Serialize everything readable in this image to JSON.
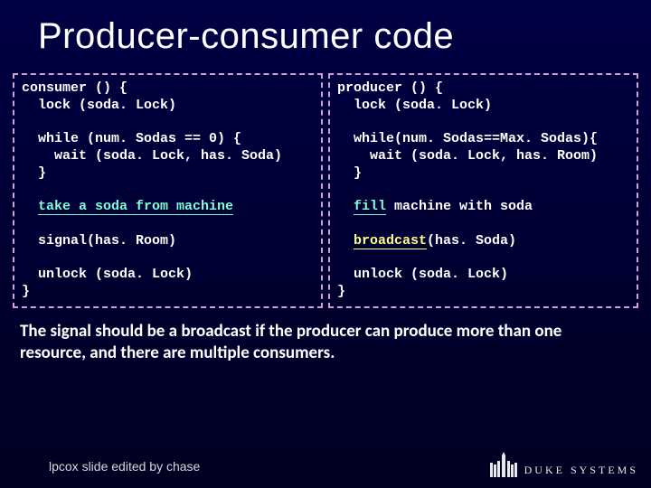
{
  "title": "Producer-consumer code",
  "consumer": {
    "l1": "consumer () {",
    "l2": "  lock (soda. Lock)",
    "l3": "",
    "l4": "  while (num. Sodas == 0) {",
    "l5": "    wait (soda. Lock, has. Soda)",
    "l6": "  }",
    "l7": "",
    "take1": "  ",
    "take2": "take a soda from machine",
    "l8": "",
    "l9": "  signal(has. Room)",
    "l10": "",
    "l11": "  unlock (soda. Lock)",
    "l12": "}"
  },
  "producer": {
    "l1": "producer () {",
    "l2": "  lock (soda. Lock)",
    "l3": "",
    "l4": "  while(num. Sodas==Max. Sodas){",
    "l5": "    wait (soda. Lock, has. Room)",
    "l6": "  }",
    "l7": "",
    "fill1": "  ",
    "fill2": "fill",
    "fill3": " machine with soda",
    "l8": "",
    "bc1": "  ",
    "bc2": "broadcast",
    "bc3": "(has. Soda)",
    "l10": "",
    "l11": "  unlock (soda. Lock)",
    "l12": "}"
  },
  "caption": "The signal should be a broadcast if the producer can produce more than one resource, and there are multiple consumers.",
  "footer_left": "lpcox slide edited by chase",
  "footer_logo_text": "Duke Systems"
}
